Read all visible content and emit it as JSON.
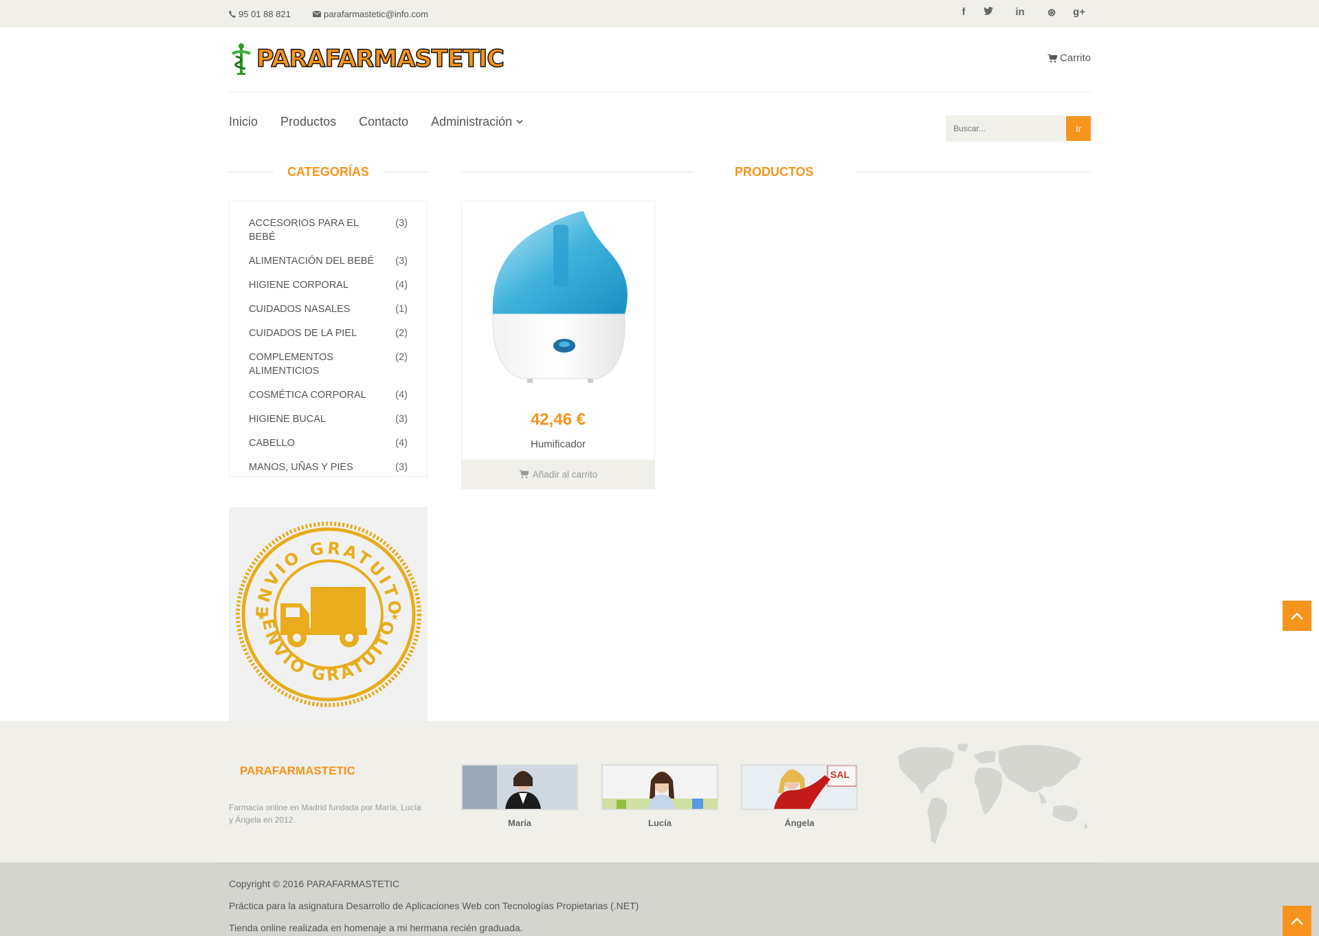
{
  "topbar": {
    "phone": "95 01 88 821",
    "email": "parafarmastetic@info.com",
    "social": [
      {
        "icon": "facebook-icon",
        "glyph": "f"
      },
      {
        "icon": "twitter-icon",
        "glyph": "t"
      },
      {
        "icon": "linkedin-icon",
        "glyph": "in"
      },
      {
        "icon": "dribbble-icon",
        "glyph": "⊛"
      },
      {
        "icon": "google-plus-icon",
        "glyph": "g+"
      }
    ]
  },
  "header": {
    "brand": "PARAFARMASTETIC",
    "cart_label": "Carrito"
  },
  "nav": {
    "items": [
      "Inicio",
      "Productos",
      "Contacto",
      "Administración"
    ],
    "search_placeholder": "Buscar...",
    "search_button": "Ir"
  },
  "sidebar": {
    "title": "CATEGORÍAS",
    "categories": [
      {
        "name": "ACCESORIOS PARA EL BEBÉ",
        "count": "(3)"
      },
      {
        "name": "ALIMENTACIÓN DEL BEBÉ",
        "count": "(3)"
      },
      {
        "name": "HIGIENE CORPORAL",
        "count": "(4)"
      },
      {
        "name": "CUIDADOS NASALES",
        "count": "(1)"
      },
      {
        "name": "CUIDADOS DE LA PIEL",
        "count": "(2)"
      },
      {
        "name": "COMPLEMENTOS ALIMENTICIOS",
        "count": "(2)"
      },
      {
        "name": "COSMÉTICA CORPORAL",
        "count": "(4)"
      },
      {
        "name": "HIGIENE BUCAL",
        "count": "(3)"
      },
      {
        "name": "CABELLO",
        "count": "(4)"
      },
      {
        "name": "MANOS, UÑAS Y PIES",
        "count": "(3)"
      }
    ],
    "badge_text": "ENVIO GRATUITO"
  },
  "products": {
    "title": "PRODUCTOS",
    "items": [
      {
        "price": "42,46 €",
        "name": "Humificador",
        "add_label": "Añadir al carrito"
      }
    ]
  },
  "footer": {
    "brand": "PARAFARMASTETIC",
    "description": "Farmacia online en Madrid fundada por María, Lucía y Ángela en 2012.",
    "people": [
      "María",
      "Lucía",
      "Ángela"
    ],
    "copyright": "Copyright © 2016 PARAFARMASTETIC",
    "line2": "Práctica para la asignatura Desarrollo de Aplicaciones Web con Tecnologías Propietarias (.NET)",
    "line3": "Tienda online realizada en homenaje a mi hermana recién graduada."
  },
  "colors": {
    "accent": "#f7941d",
    "bar": "#f0efe9",
    "copy_bar": "#d5d5d0"
  }
}
